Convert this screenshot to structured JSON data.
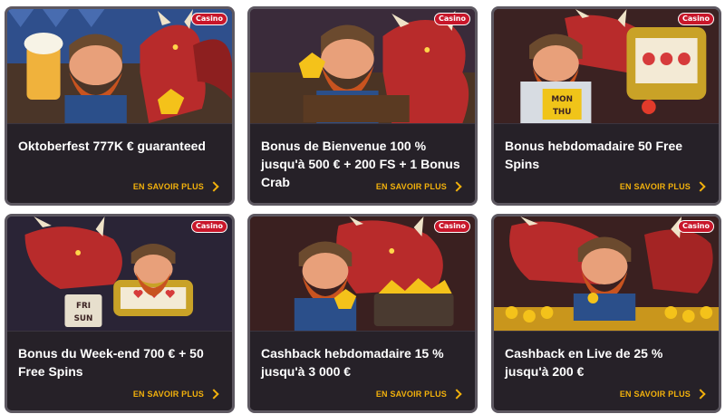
{
  "promotions": [
    {
      "title": "Oktoberfest 777K € guaranteed",
      "badge": "Casino",
      "cta": "EN SAVOIR PLUS",
      "art": "oktoberfest-dwarf-beer-dragon-illustration"
    },
    {
      "title": "Bonus de Bienvenue 100 % jusqu'à 500 € + 200 FS + 1 Bonus Crab",
      "badge": "Casino",
      "cta": "EN SAVOIR PLUS",
      "art": "dwarf-gold-nugget-dragon-illustration"
    },
    {
      "title": "Bonus hebdomadaire 50 Free Spins",
      "badge": "Casino",
      "cta": "EN SAVOIR PLUS",
      "art": "dwarf-slot-machine-mon-thu-illustration",
      "art_text": [
        "MON",
        "THU"
      ]
    },
    {
      "title": "Bonus du Week-end 700 € + 50 Free Spins",
      "badge": "Casino",
      "cta": "EN SAVOIR PLUS",
      "art": "dwarf-slot-machine-fri-sun-illustration",
      "art_text": [
        "FRI",
        "SUN"
      ]
    },
    {
      "title": "Cashback hebdomadaire 15 % jusqu'à 3 000 €",
      "badge": "Casino",
      "cta": "EN SAVOIR PLUS",
      "art": "dwarf-gold-minecart-dragon-illustration"
    },
    {
      "title": "Cashback en Live de 25 % jusqu'à 200 €",
      "badge": "Casino",
      "cta": "EN SAVOIR PLUS",
      "art": "dwarf-coin-pile-dragon-illustration"
    }
  ],
  "colors": {
    "card_bg": "#262128",
    "card_border": "#5d5861",
    "cta": "#f2b10c",
    "badge": "#c8162a",
    "dragon": "#b82b2b",
    "dwarf_beard": "#c8531f",
    "gold": "#f4c21a"
  }
}
